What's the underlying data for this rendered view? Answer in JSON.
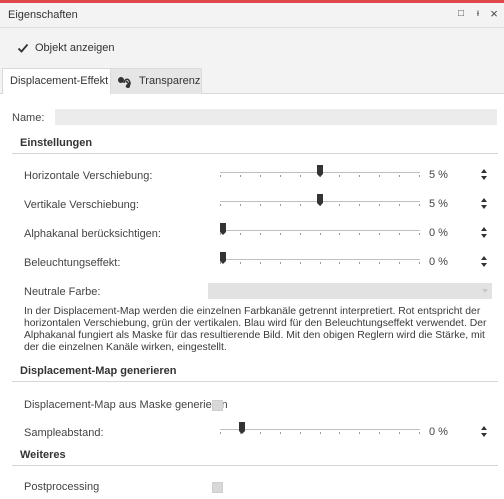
{
  "panel": {
    "title": "Eigenschaften",
    "accent_color": "#e0474c",
    "controls": [
      "restore-icon",
      "pin-icon",
      "close-icon"
    ],
    "restore_glyph": "□",
    "pin_glyph": "ᵻ",
    "close_glyph": "×"
  },
  "show_object": {
    "label": "Objekt anzeigen",
    "checked": true
  },
  "tabs": [
    {
      "label": "Displacement-Effekt",
      "active": true
    },
    {
      "label": "Transparenz",
      "active": false,
      "icon": "transparency-icon"
    }
  ],
  "name_field": {
    "label": "Name:",
    "value": ""
  },
  "sections": {
    "settings": "Einstellungen",
    "generate": "Displacement-Map generieren",
    "more": "Weiteres"
  },
  "settings": {
    "horizontal": {
      "label": "Horizontale Verschiebung:",
      "value": "5 %",
      "position": 0.5
    },
    "vertical": {
      "label": "Vertikale Verschiebung:",
      "value": "5 %",
      "position": 0.5
    },
    "alpha": {
      "label": "Alphakanal berücksichtigen:",
      "value": "0 %",
      "position": 0.0
    },
    "lighting": {
      "label": "Beleuchtungseffekt:",
      "value": "0 %",
      "position": 0.0
    },
    "neutral_color": {
      "label": "Neutrale Farbe:"
    }
  },
  "description": "In der Displacement-Map werden die einzelnen Farbkanäle getrennt interpretiert. Rot entspricht der horizontalen Verschiebung, grün der vertikalen. Blau wird für den Beleuchtungseffekt verwendet. Der Alphakanal fungiert als Maske für das resultierende Bild. Mit den obigen Reglern wird die Stärke, mit der die einzelnen Kanäle wirken, eingestellt.",
  "generate": {
    "from_mask": {
      "label": "Displacement-Map aus Maske generieren",
      "checked": false
    },
    "sample_distance": {
      "label": "Sampleabstand:",
      "value": "0 %",
      "position": 0.1
    }
  },
  "more": {
    "postprocessing": {
      "label": "Postprocessing",
      "checked": false
    }
  }
}
